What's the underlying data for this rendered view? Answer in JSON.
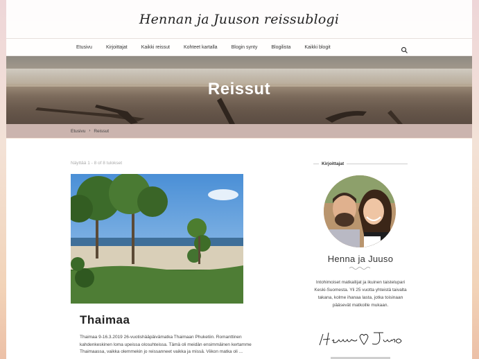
{
  "site": {
    "title": "Hennan ja Juuson reissublogi"
  },
  "nav": {
    "items": [
      "Etusivu",
      "Kirjoittajat",
      "Kaikki reissut",
      "Kohteet kartalla",
      "Blogin synty",
      "Blogilista",
      "Kaikki blogit"
    ],
    "search_icon": "search-icon"
  },
  "hero": {
    "title": "Reissut"
  },
  "breadcrumb": {
    "home": "Etusivu",
    "separator": "›",
    "current": "Reissut"
  },
  "listing": {
    "results_text": "Näyttää 1 - 8 of 8 tulokset",
    "post": {
      "title": "Thaimaa",
      "excerpt": "Thaimaa 9-16.3.2019 26-vuotishääpäivämatka Thaimaan Phuketiin. Romanttinen kahdenkeskinen loma upeissa olosuhteissa. Tämä oli meidän ensimmäinen kertamme Thaimaassa, vaikka olemmekin jo reissanneet vaikka ja missä. Viikon matka oli ..."
    }
  },
  "sidebar": {
    "heading": "Kirjoittajat",
    "author_name": "Henna ja Juuso",
    "author_bio": "Intohimoiset matkailijat ja ikuinen taistelupari Keski-Suomesta. Yli 25 vuotta yhteistä taivalta takana, kolme ihanaa lasta, jotka toisinaan pääsevät matkoille mukaan.",
    "signature": "Henna ♡ Juuso"
  },
  "colors": {
    "breadcrumb_bg": "#cbb4ae",
    "text": "#333333"
  }
}
